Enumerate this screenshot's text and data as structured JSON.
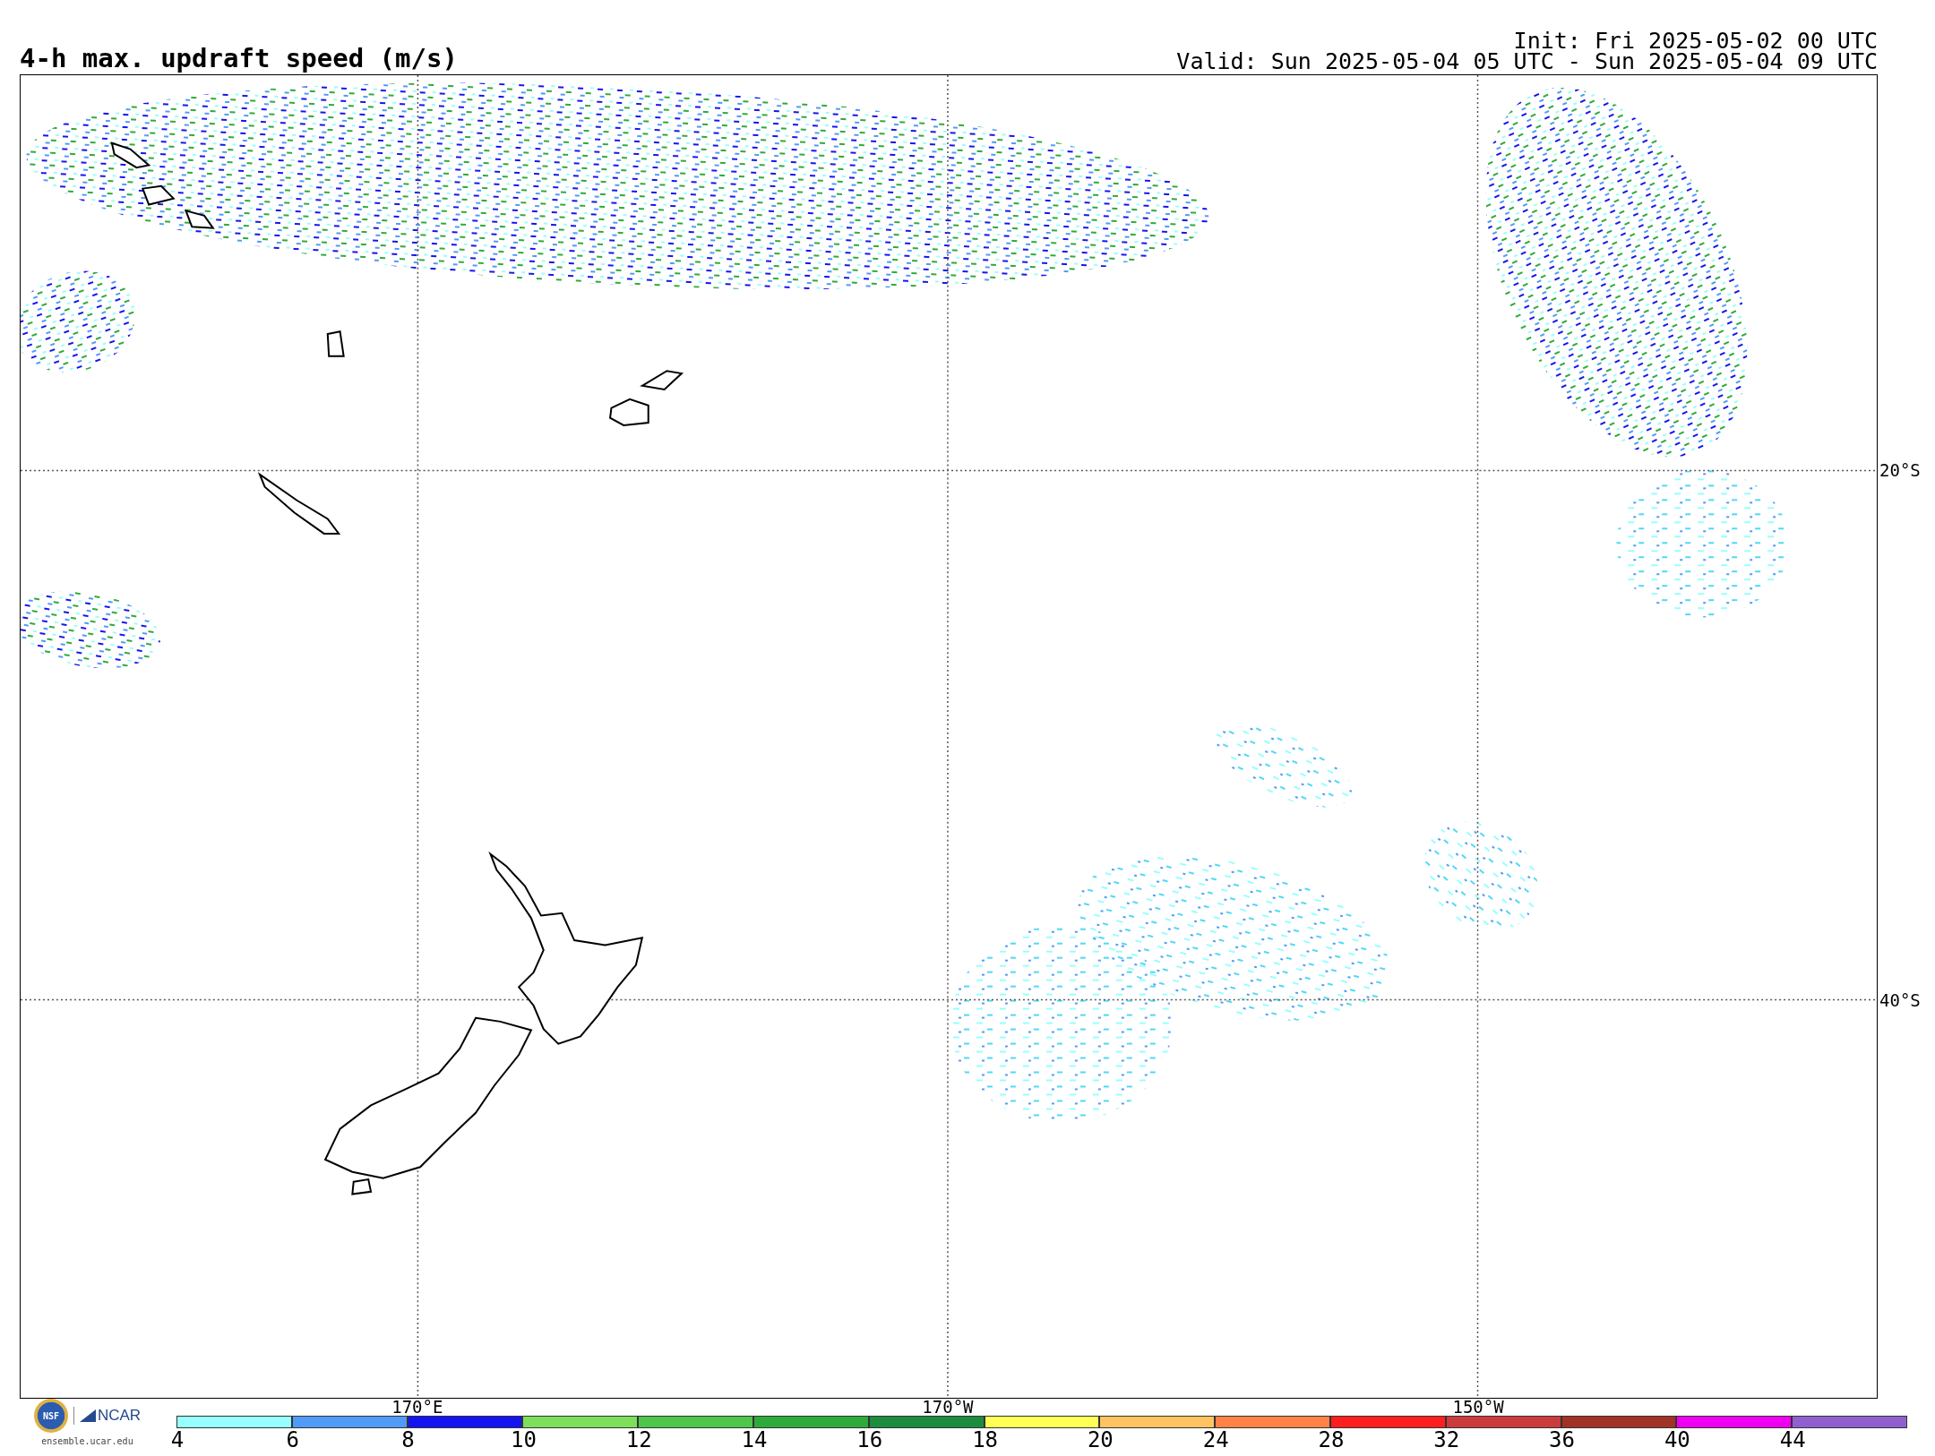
{
  "title": "4-h max. updraft speed (m/s)",
  "init": "Init: Fri 2025-05-02 00 UTC",
  "valid": "Valid: Sun 2025-05-04 05 UTC - Sun 2025-05-04 09 UTC",
  "map": {
    "lat_labels": [
      "20°S",
      "40°S"
    ],
    "lon_labels": [
      "170°E",
      "170°W",
      "150°W"
    ]
  },
  "colorbar": {
    "segments": [
      {
        "color": "#96ffff",
        "label": "4"
      },
      {
        "color": "#4f9bf7",
        "label": "6"
      },
      {
        "color": "#1414f0",
        "label": "8"
      },
      {
        "color": "#7ddf5c",
        "label": "10"
      },
      {
        "color": "#4dc64a",
        "label": "12"
      },
      {
        "color": "#2eaa3a",
        "label": "14"
      },
      {
        "color": "#1c8c3e",
        "label": "16"
      },
      {
        "color": "#ffff55",
        "label": "18"
      },
      {
        "color": "#fec462",
        "label": "20"
      },
      {
        "color": "#ff8347",
        "label": "24"
      },
      {
        "color": "#ff1e1e",
        "label": "28"
      },
      {
        "color": "#cc3b3b",
        "label": "32"
      },
      {
        "color": "#a03226",
        "label": "36"
      },
      {
        "color": "#f000f0",
        "label": "40"
      },
      {
        "color": "#9060d0",
        "label": "44"
      }
    ]
  },
  "footer": {
    "seal_text": "NSF",
    "logo_text": "NCAR",
    "site": "ensemble.ucar.edu"
  }
}
